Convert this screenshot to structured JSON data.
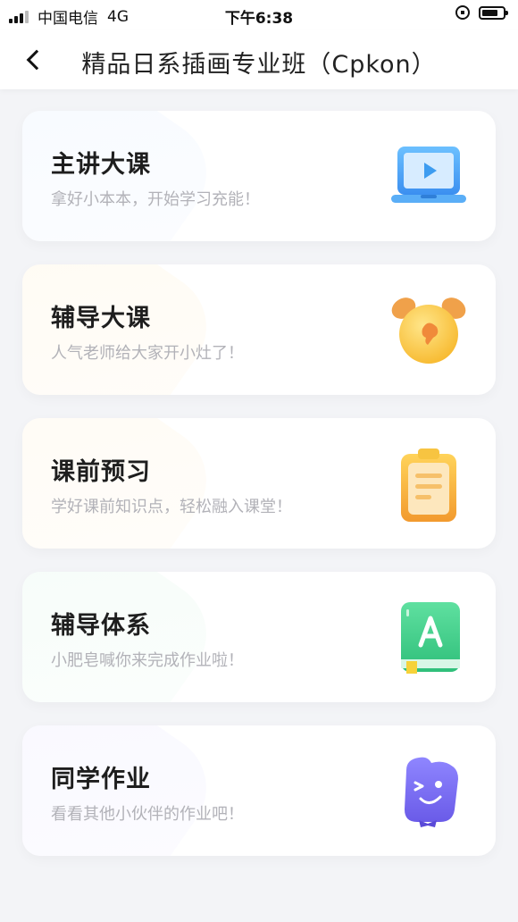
{
  "status_bar": {
    "carrier": "中国电信",
    "network": "4G",
    "time": "下午6:38"
  },
  "nav": {
    "title": "精品日系插画专业班（Cpkon）"
  },
  "cards": [
    {
      "title": "主讲大课",
      "subtitle": "拿好小本本，开始学习充能！",
      "icon": "laptop-play-icon",
      "accent": "#3d9cf0"
    },
    {
      "title": "辅导大课",
      "subtitle": "人气老师给大家开小灶了！",
      "icon": "alarm-clock-icon",
      "accent": "#f5b93a"
    },
    {
      "title": "课前预习",
      "subtitle": "学好课前知识点，轻松融入课堂！",
      "icon": "clipboard-icon",
      "accent": "#f3a93a"
    },
    {
      "title": "辅导体系",
      "subtitle": "小肥皂喊你来完成作业啦！",
      "icon": "book-a-icon",
      "accent": "#3fcf8c"
    },
    {
      "title": "同学作业",
      "subtitle": "看看其他小伙伴的作业吧！",
      "icon": "mascot-face-icon",
      "accent": "#7b6cf0"
    }
  ]
}
